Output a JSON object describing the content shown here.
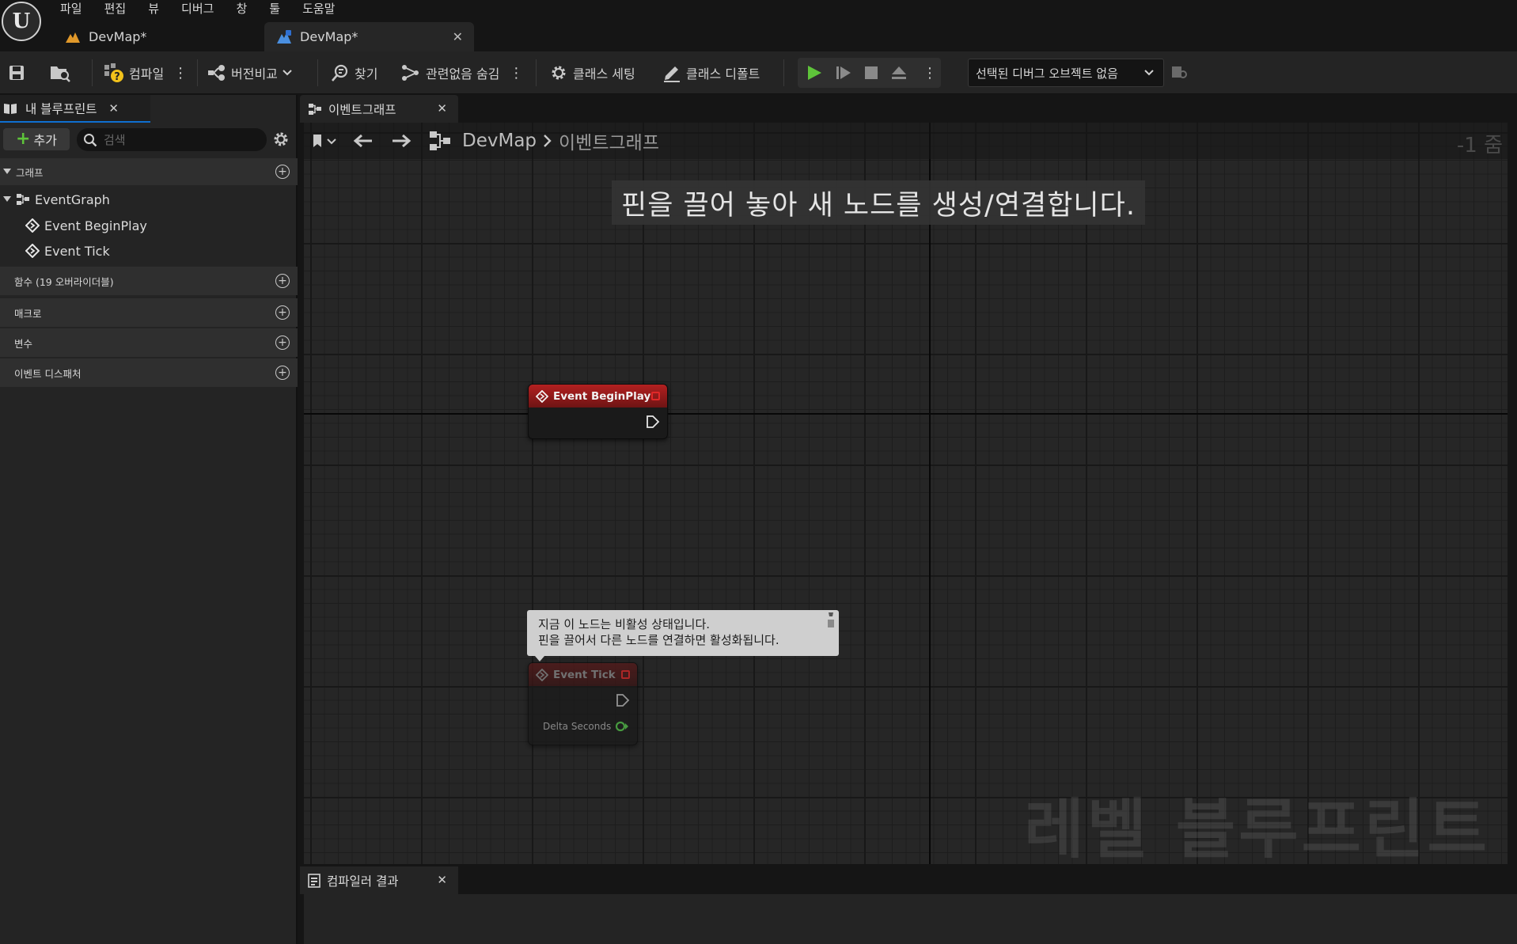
{
  "menu": [
    "파일",
    "편집",
    "뷰",
    "디버그",
    "창",
    "툴",
    "도움말"
  ],
  "doc_tabs": [
    {
      "label": "DevMap*",
      "icon": "level-icon"
    },
    {
      "label": "DevMap*",
      "icon": "level-blueprint-icon",
      "active": true
    }
  ],
  "toolbar": {
    "compile_label": "컴파일",
    "diff_label": "버전비교",
    "find_label": "찾기",
    "hide_unrelated_label": "관련없음 숨김",
    "class_settings_label": "클래스 세팅",
    "class_defaults_label": "클래스 디폴트",
    "debug_object_label": "선택된 디버그 오브젝트 없음"
  },
  "my_blueprint": {
    "tab_label": "내 블루프린트",
    "add_label": "추가",
    "search_placeholder": "검색",
    "sections": {
      "graphs": "그래프",
      "functions": "함수 (19 오버라이더블)",
      "macros": "매크로",
      "variables": "변수",
      "dispatchers": "이벤트 디스패처"
    },
    "graph_items": {
      "event_graph": "EventGraph",
      "begin_play": "Event BeginPlay",
      "tick": "Event Tick"
    }
  },
  "graph_tab_label": "이벤트그래프",
  "breadcrumb": {
    "root": "DevMap",
    "separator": ">",
    "current": "이벤트그래프"
  },
  "zoom_label": "-1 줌",
  "hint_text": "핀을 끌어 놓아 새 노드를 생성/연결합니다.",
  "watermark": "레벨 블루프린트",
  "nodes": {
    "begin_play_title": "Event BeginPlay",
    "tick_title": "Event Tick",
    "tick_pin_label": "Delta Seconds"
  },
  "tooltip": {
    "line1": "지금 이 노드는 비활성 상태입니다.",
    "line2": "핀을 끌어서 다른 노드를 연결하면 활성화됩니다."
  },
  "bottom_tab_label": "컴파일러 결과",
  "colors": {
    "node_header": "#9b1c1c",
    "play_green": "#5ec43a",
    "exec_pin": "#e6e6e6",
    "float_pin": "#55c64a",
    "accent_blue": "#0f6fd0"
  }
}
